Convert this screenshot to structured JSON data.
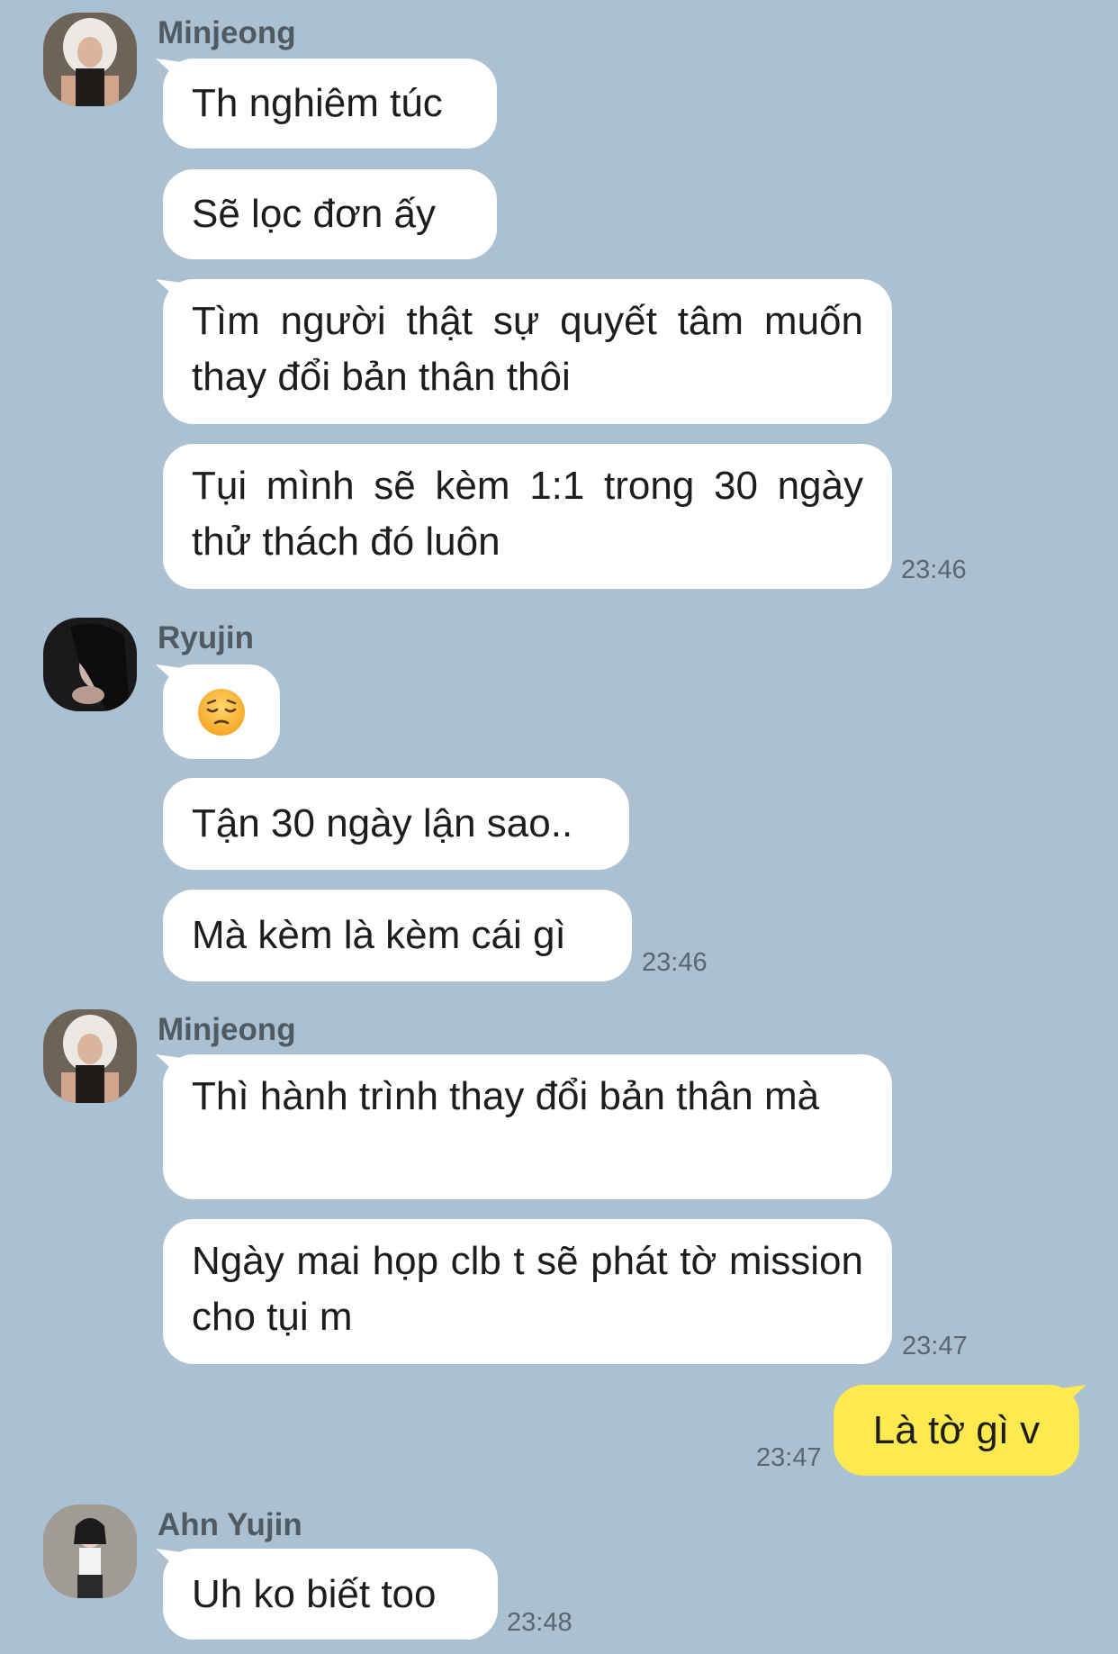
{
  "groups": [
    {
      "sender": "Minjeong",
      "messages": [
        "Th nghiêm túc",
        "Sẽ lọc đơn ấy",
        "Tìm người thật sự quyết tâm muốn thay đổi bản thân thôi",
        "Tụi mình sẽ kèm 1:1 trong 30 ngày thử thách đó luôn"
      ],
      "time": "23:46"
    },
    {
      "sender": "Ryujin",
      "emoji": "pensive-face",
      "messages": [
        "",
        "Tận 30 ngày lận sao..",
        "Mà kèm là kèm cái gì"
      ],
      "time": "23:46"
    },
    {
      "sender": "Minjeong",
      "messages": [
        "Thì hành trình thay đổi bản thân mà",
        "Ngày mai họp clb t sẽ phát tờ mission cho tụi m"
      ],
      "time": "23:47"
    },
    {
      "sender": "Ahn Yujin",
      "messages": [
        "Uh ko biết too"
      ],
      "time": "23:48"
    }
  ],
  "outgoing": {
    "text": "Là tờ gì v",
    "time": "23:47"
  },
  "colors": {
    "background": "#abc1d1",
    "incoming_bubble": "#ffffff",
    "outgoing_bubble": "#fee94f"
  }
}
